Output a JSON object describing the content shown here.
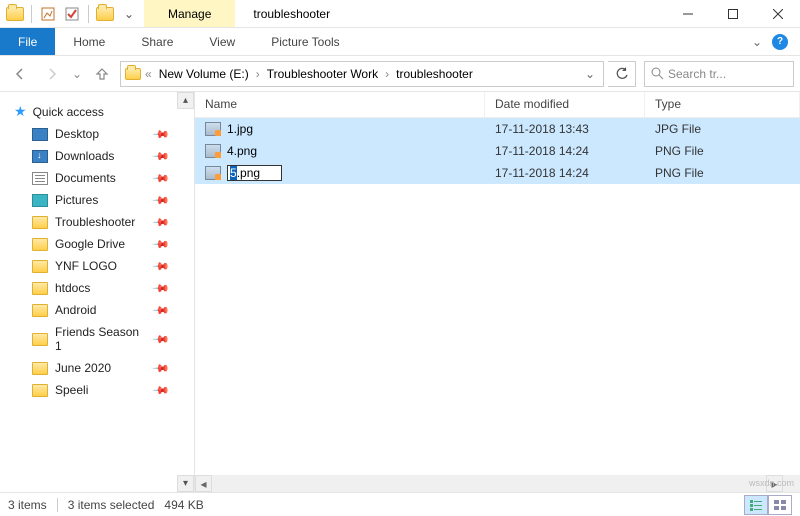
{
  "titlebar": {
    "context_tab": "Manage",
    "window_title": "troubleshooter"
  },
  "ribbon": {
    "file": "File",
    "home": "Home",
    "share": "Share",
    "view": "View",
    "context_tool": "Picture Tools"
  },
  "breadcrumb": {
    "overflow": "«",
    "parts": [
      "New Volume (E:)",
      "Troubleshooter Work",
      "troubleshooter"
    ]
  },
  "search": {
    "placeholder": "Search tr..."
  },
  "sidebar": {
    "header": "Quick access",
    "items": [
      {
        "label": "Desktop",
        "icon": "desktop",
        "pinned": true
      },
      {
        "label": "Downloads",
        "icon": "down",
        "pinned": true
      },
      {
        "label": "Documents",
        "icon": "docs",
        "pinned": true
      },
      {
        "label": "Pictures",
        "icon": "pics",
        "pinned": true
      },
      {
        "label": "Troubleshooter",
        "icon": "folder",
        "pinned": true
      },
      {
        "label": "Google Drive",
        "icon": "folder",
        "pinned": true
      },
      {
        "label": "YNF LOGO",
        "icon": "folder",
        "pinned": true
      },
      {
        "label": "htdocs",
        "icon": "folder",
        "pinned": true
      },
      {
        "label": "Android",
        "icon": "folder",
        "pinned": true
      },
      {
        "label": "Friends Season 1",
        "icon": "folder",
        "pinned": true
      },
      {
        "label": "June 2020",
        "icon": "folder",
        "pinned": true
      },
      {
        "label": "Speeli",
        "icon": "folder",
        "pinned": true
      }
    ]
  },
  "columns": {
    "name": "Name",
    "date": "Date modified",
    "type": "Type"
  },
  "files": [
    {
      "name": "1.jpg",
      "date": "17-11-2018 13:43",
      "type": "JPG File",
      "renaming": false
    },
    {
      "name": "4.png",
      "date": "17-11-2018 14:24",
      "type": "PNG File",
      "renaming": false
    },
    {
      "name_sel": "5",
      "name_rest": ".png",
      "date": "17-11-2018 14:24",
      "type": "PNG File",
      "renaming": true
    }
  ],
  "status": {
    "count": "3 items",
    "selected": "3 items selected",
    "size": "494 KB"
  },
  "watermark": "wsxdn.com"
}
